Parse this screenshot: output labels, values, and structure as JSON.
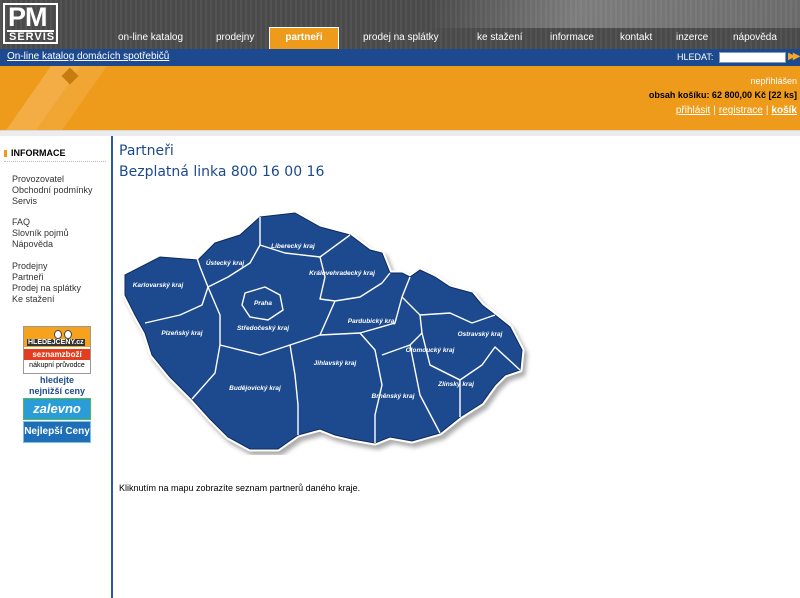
{
  "logo": {
    "line1": "PM",
    "line2": "SERVIS"
  },
  "nav": {
    "tabs": [
      {
        "label": "on-line katalog"
      },
      {
        "label": "prodejny"
      },
      {
        "label": "partneři",
        "active": true
      },
      {
        "label": "prodej na splátky"
      },
      {
        "label": "ke stažení"
      },
      {
        "label": "informace"
      },
      {
        "label": "kontakt"
      },
      {
        "label": "inzerce"
      },
      {
        "label": "nápověda"
      }
    ]
  },
  "bluebar": {
    "catalog_link": "On-line katalog domácích spotřebičů",
    "search_label": "HLEDAT:",
    "search_value": "",
    "search_go_icon": "double-arrow-right-icon"
  },
  "account": {
    "status": "nepřihlášen",
    "cart": "obsah košíku: 62 800,00 Kč [22 ks]",
    "links": {
      "login": "přihlásit",
      "register": "registrace",
      "cart": "košík",
      "separator": "|"
    }
  },
  "sidebar": {
    "heading": "INFORMACE",
    "groups": [
      [
        "Provozovatel",
        "Obchodní podmínky",
        "Servis"
      ],
      [
        "FAQ",
        "Slovník pojmů",
        "Nápověda"
      ],
      [
        "Prodejny",
        "Partneři",
        "Prodej na splátky",
        "Ke stažení"
      ]
    ],
    "banners": {
      "hledejceny_top": "HLEDEJCENY.cz",
      "seznam": "seznamzboží",
      "pruvodce": "nákupní průvodce",
      "text": "hledejte nejnižší ceny",
      "zalevno": "zalevno",
      "nejlepsi": "Nejlepší Ceny"
    }
  },
  "main": {
    "title": "Partneři",
    "hotline": "Bezplatná linka 800 16 00 16",
    "note": "Kliknutím na mapu zobrazíte seznam partnerů daného kraje."
  },
  "map": {
    "fill_color": "#1d4a8e",
    "regions": [
      "Karlovarský kraj",
      "Ústecký kraj",
      "Liberecký kraj",
      "Královehradecký kraj",
      "Praha",
      "Středočeský kraj",
      "Plzeňský kraj",
      "Pardubický kraj",
      "Jihlavský kraj",
      "Budějovický kraj",
      "Olomoucký kraj",
      "Ostravský kraj",
      "Brněnský kraj",
      "Zlínský kraj"
    ]
  },
  "colors": {
    "orange": "#ee9a1a",
    "blue": "#1d4a8e",
    "nav_bg": "#4a4a4a"
  }
}
